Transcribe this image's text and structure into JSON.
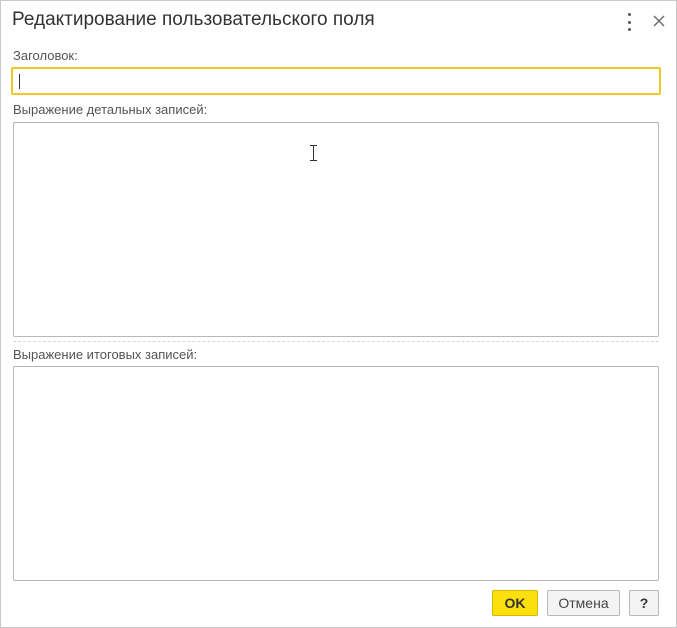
{
  "dialog": {
    "title": "Редактирование пользовательского поля"
  },
  "header_icons": {
    "menu": "more-vertical-icon",
    "close": "close-icon"
  },
  "fields": {
    "title_label": "Заголовок:",
    "title_value": "",
    "detail_label": "Выражение детальных записей:",
    "detail_value": "",
    "total_label": "Выражение итоговых записей:",
    "total_value": ""
  },
  "buttons": {
    "ok": "OK",
    "cancel": "Отмена",
    "help": "?"
  },
  "colors": {
    "accent_yellow": "#fbe00e",
    "focus_border": "#f0c828"
  }
}
